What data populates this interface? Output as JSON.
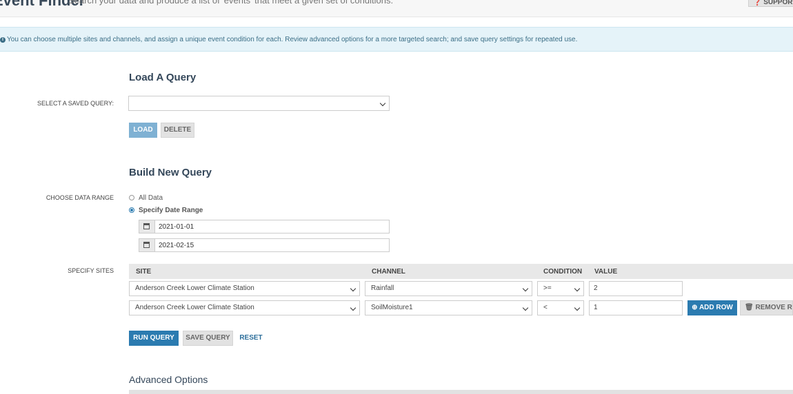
{
  "header": {
    "title": "Event Finder",
    "subtitle": "Search your data and produce a list of 'events' that meet a given set of conditions.",
    "support_label": "SUPPORT"
  },
  "info": {
    "text": "You can choose multiple sites and channels, and assign a unique event condition for each. Review advanced options for a more targeted search; and save query settings for repeated use."
  },
  "load_query": {
    "title": "Load A Query",
    "select_label": "SELECT A SAVED QUERY:",
    "selected_value": "",
    "load_label": "LOAD",
    "delete_label": "DELETE"
  },
  "build_query": {
    "title": "Build New Query",
    "data_range_label": "CHOOSE DATA RANGE",
    "option_all": "All Data",
    "option_specify": "Specify Date Range",
    "selected_option": "Specify Date Range",
    "start_date": "2021-01-01",
    "end_date": "2021-02-15",
    "sites_label": "SPECIFY SITES",
    "columns": [
      "SITE",
      "CHANNEL",
      "CONDITION",
      "VALUE"
    ],
    "rows": [
      {
        "site": "Anderson Creek Lower Climate Station",
        "channel": "Rainfall",
        "condition": ">=",
        "value": "2"
      },
      {
        "site": "Anderson Creek Lower Climate Station",
        "channel": "SoilMoisture1",
        "condition": "<",
        "value": "1"
      }
    ],
    "add_row_label": "ADD ROW",
    "remove_row_label": "REMOVE ROW",
    "run_label": "RUN QUERY",
    "save_label": "SAVE QUERY",
    "reset_label": "RESET"
  },
  "advanced": {
    "title": "Advanced Options"
  },
  "colors": {
    "primary": "#2b7bb0",
    "info_bg": "#e5f3f9",
    "heading": "#34475a"
  }
}
